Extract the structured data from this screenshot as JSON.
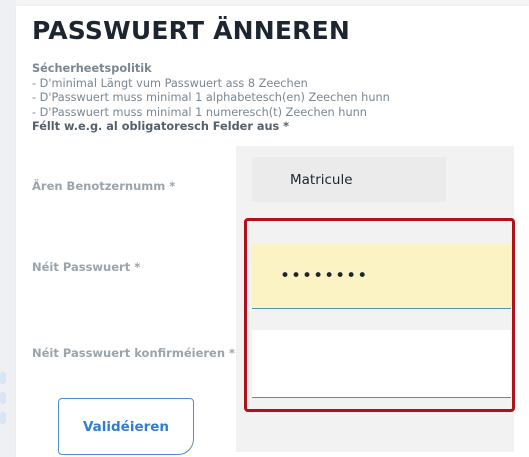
{
  "page": {
    "title": "PASSWUERT ÄNNEREN"
  },
  "policy": {
    "heading": "Sécherheetspolitik",
    "rules": [
      "- D'minimal Längt vum Passwuert ass 8 Zeechen",
      "- D'Passwuert muss minimal 1 alphabetesch(en) Zeechen hunn",
      "- D'Passwuert muss minimal 1 numeresch(t) Zeechen hunn"
    ],
    "required_note": "Féllt w.e.g. al obligatoresch Felder aus *"
  },
  "form": {
    "username": {
      "label": "Ären Benotzernumm *",
      "placeholder": "Matricule"
    },
    "new_password": {
      "label": "Néit Passwuert *",
      "value": "pwdvalue"
    },
    "confirm_password": {
      "label": "Néit Passwuert konfirméieren *",
      "value": ""
    },
    "submit_label": "Validéieren"
  },
  "colors": {
    "title": "#1d2630",
    "label": "#9aa4ad",
    "autofill_bg": "#fbf3c4",
    "focus_underline": "#4f90c6",
    "highlight_border": "#b0121b",
    "button_text": "#2f7ed1"
  }
}
